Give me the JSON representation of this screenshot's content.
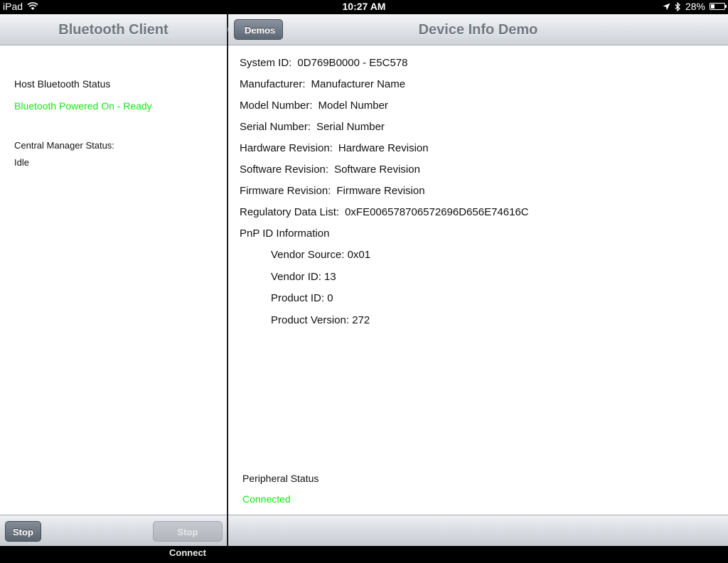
{
  "status_bar": {
    "device": "iPad",
    "time": "10:27 AM",
    "battery": "28%",
    "battery_level": 0.28
  },
  "master": {
    "title": "Bluetooth Client",
    "host_status_label": "Host Bluetooth Status",
    "host_status_value": "Bluetooth Powered On - Ready",
    "central_label": "Central Manager Status:",
    "central_value": "Idle",
    "toolbar": {
      "stop_label": "Stop",
      "stop_connect_label": "Stop Connect"
    }
  },
  "detail": {
    "back_label": "Demos",
    "title": "Device Info Demo",
    "fields": [
      {
        "label": "System ID:",
        "value": "0D769B0000  - E5C578"
      },
      {
        "label": "Manufacturer:",
        "value": "Manufacturer Name"
      },
      {
        "label": "Model Number:",
        "value": "Model Number"
      },
      {
        "label": "Serial Number:",
        "value": "Serial Number"
      },
      {
        "label": "Hardware Revision:",
        "value": "Hardware Revision"
      },
      {
        "label": "Software Revision:",
        "value": "Software Revision"
      },
      {
        "label": "Firmware Revision:",
        "value": "Firmware Revision"
      },
      {
        "label": "Regulatory Data List:",
        "value": "0xFE006578706572696D656E74616C"
      }
    ],
    "pnp_heading": "PnP ID Information",
    "pnp": [
      "Vendor Source: 0x01",
      "Vendor ID: 13",
      "Product ID: 0",
      "Product Version: 272"
    ],
    "peripheral_label": "Peripheral Status",
    "peripheral_value": "Connected"
  },
  "colors": {
    "status_green": "#19e619"
  }
}
